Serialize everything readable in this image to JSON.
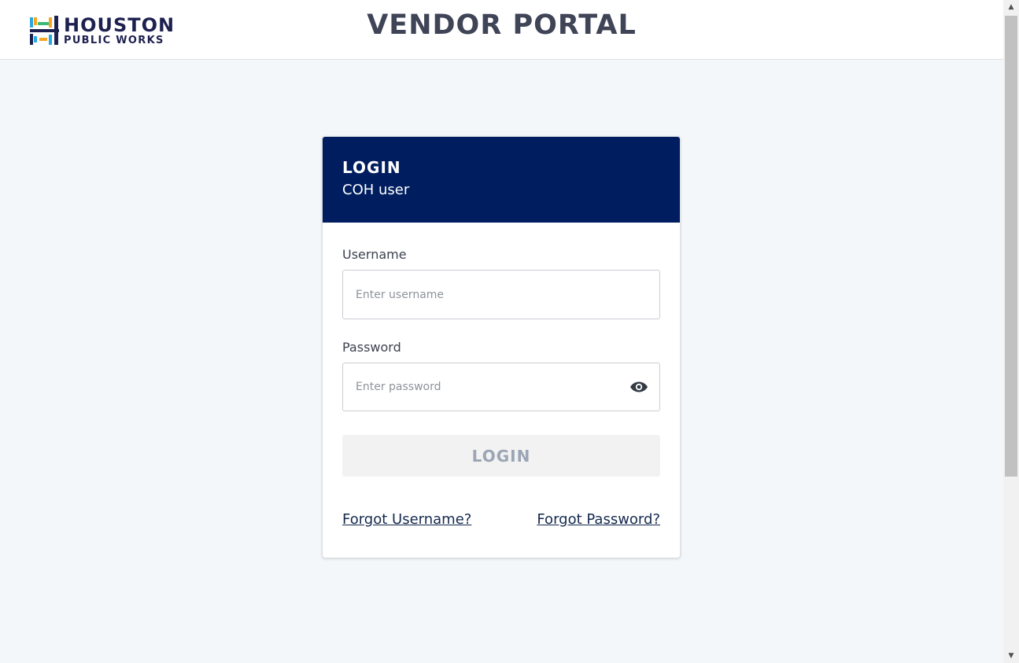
{
  "header": {
    "logo": {
      "line1": "HOUSTON",
      "line2": "PUBLIC WORKS",
      "icon": "houston-h-logo-icon"
    },
    "title": "VENDOR PORTAL"
  },
  "login_card": {
    "title": "LOGIN",
    "subtitle": "COH user",
    "username": {
      "label": "Username",
      "placeholder": "Enter username",
      "value": ""
    },
    "password": {
      "label": "Password",
      "placeholder": "Enter password",
      "value": "",
      "toggle_icon": "eye-icon"
    },
    "login_button": "LOGIN",
    "forgot_username": "Forgot Username?",
    "forgot_password": "Forgot Password?"
  },
  "colors": {
    "header_band": "#001e5f",
    "page_background": "#f4f7fa",
    "title_text": "#3f4456",
    "button_disabled_bg": "#f2f2f2",
    "button_disabled_text": "#9ba5b5",
    "link_text": "#14294e"
  }
}
